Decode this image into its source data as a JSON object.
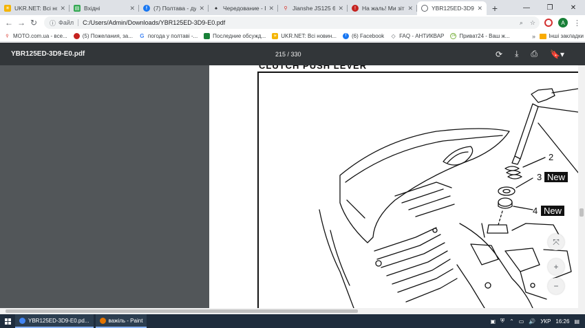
{
  "tabs": [
    {
      "title": "UKR.NET: Всі нови",
      "color": "#f4b400"
    },
    {
      "title": "Вхідні",
      "color": "#34a853"
    },
    {
      "title": "(7) Полтава - дух",
      "color": "#1877f2"
    },
    {
      "title": "Чередование - П",
      "color": "#202124"
    },
    {
      "title": "Jianshe JS125 6-а",
      "color": "#d93025"
    },
    {
      "title": "На жаль! Ми зітк",
      "color": "#c5221f"
    },
    {
      "title": "YBR125ED-3D9-E0",
      "color": "#5f6368"
    }
  ],
  "address": {
    "scheme": "Файл",
    "url": "C:/Users/Admin/Downloads/YBR125ED-3D9-E0.pdf",
    "avatar_letter": "A"
  },
  "bookmarks": [
    {
      "label": "MOTO.com.ua - все...",
      "color": "#d93025"
    },
    {
      "label": "(5) Пожелания, за...",
      "color": "#c5221f"
    },
    {
      "label": "погода у полтаві -...",
      "color": "#4285f4"
    },
    {
      "label": "Последние обсужд...",
      "color": "#188038"
    },
    {
      "label": "UKR.NET: Всі новин...",
      "color": "#f4b400"
    },
    {
      "label": "(6) Facebook",
      "color": "#1877f2"
    },
    {
      "label": "FAQ - АНТИКВАР",
      "color": "#5f6368"
    },
    {
      "label": "Приват24 - Ваш ж...",
      "color": "#7cb342"
    }
  ],
  "bookmarks_more": "»",
  "bookmarks_other": "Інші закладки",
  "pdf": {
    "title": "YBR125ED-3D9-E0.pdf",
    "pages": "215 / 330",
    "section_title": "CLUTCH PUSH LEVER",
    "callouts": {
      "c2": "2",
      "c3": "3",
      "c4": "4",
      "new3": "New",
      "new4": "New"
    }
  },
  "taskbar": {
    "items": [
      {
        "label": "YBR125ED-3D9-E0.pd...",
        "color": "#4285f4"
      },
      {
        "label": "важіль - Paint",
        "color": "#e37400"
      }
    ],
    "lang": "УКР",
    "time": "16:26"
  }
}
